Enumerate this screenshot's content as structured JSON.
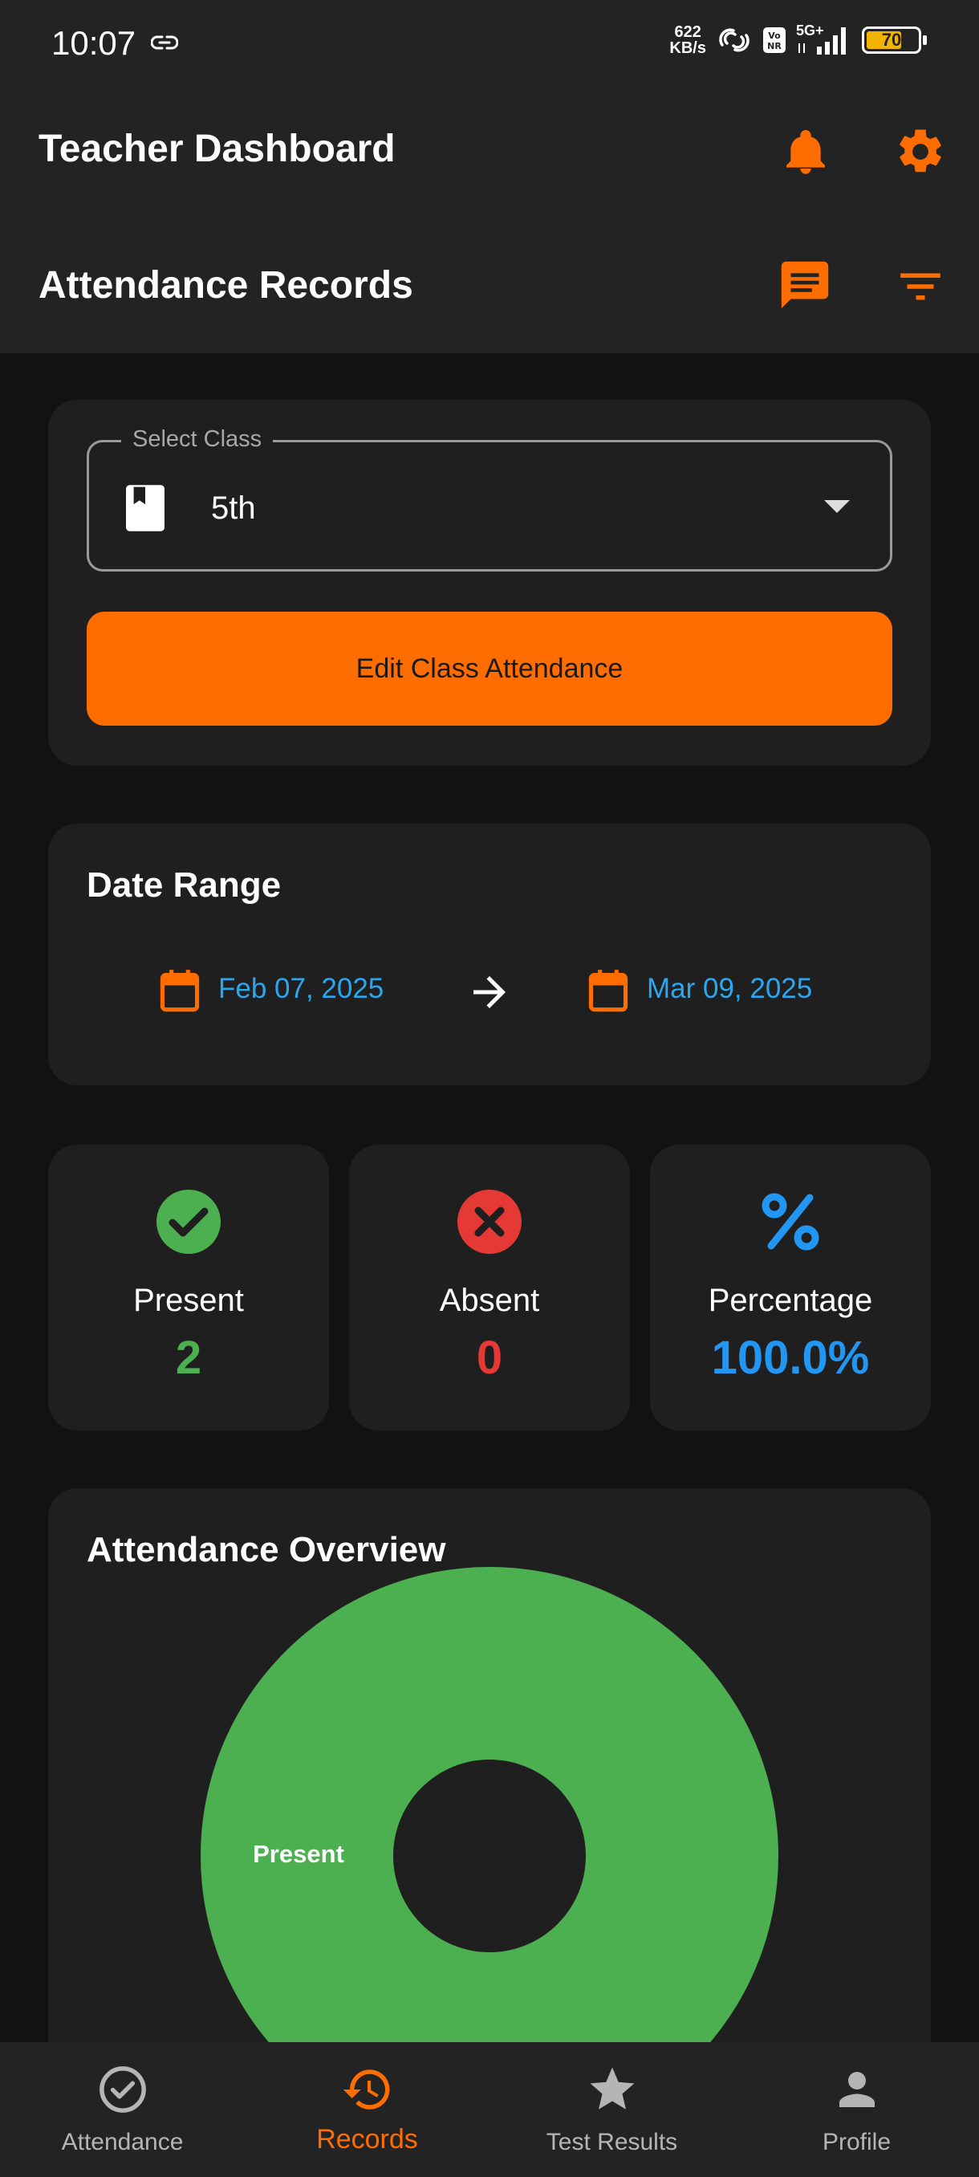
{
  "status_bar": {
    "time": "10:07",
    "speed_value": "622",
    "speed_unit": "KB/s",
    "network": "5G+",
    "battery": "70"
  },
  "header": {
    "title": "Teacher Dashboard",
    "subtitle": "Attendance Records"
  },
  "select_class": {
    "legend": "Select Class",
    "value": "5th",
    "edit_button": "Edit Class Attendance"
  },
  "date_range": {
    "title": "Date Range",
    "start": "Feb 07, 2025",
    "end": "Mar 09, 2025"
  },
  "stats": {
    "present_label": "Present",
    "present_value": "2",
    "absent_label": "Absent",
    "absent_value": "0",
    "percentage_label": "Percentage",
    "percentage_value": "100.0%"
  },
  "overview": {
    "title": "Attendance Overview"
  },
  "chart_data": {
    "type": "pie",
    "title": "Attendance Overview",
    "categories": [
      "Present"
    ],
    "values": [
      2
    ],
    "colors": [
      "#4caf50"
    ],
    "donut": true
  },
  "bottom_nav": {
    "items": [
      {
        "label": "Attendance",
        "icon": "check-circle-icon"
      },
      {
        "label": "Records",
        "icon": "history-icon"
      },
      {
        "label": "Test Results",
        "icon": "star-icon"
      },
      {
        "label": "Profile",
        "icon": "person-icon"
      }
    ],
    "active": "Records"
  },
  "colors": {
    "accent": "#ff6d00",
    "present": "#4caf50",
    "absent": "#e53935",
    "percentage": "#2196f3",
    "date": "#2aa7ee"
  }
}
